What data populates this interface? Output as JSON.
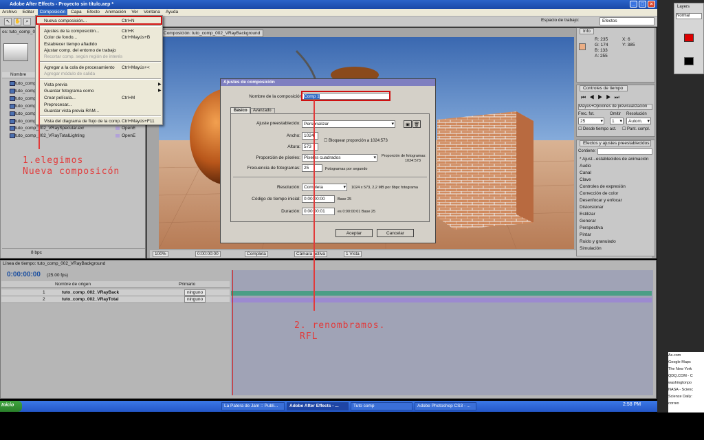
{
  "app": {
    "title": "Adobe After Effects - Proyecto sin título.aep *",
    "menu": [
      "Archivo",
      "Editar",
      "Composición",
      "Capa",
      "Efecto",
      "Animación",
      "Ver",
      "Ventana",
      "Ayuda"
    ],
    "workspace_label": "Espacio de trabajo:",
    "workspace_value": "Efectos"
  },
  "composition_menu": {
    "items": [
      {
        "label": "Nueva composición...",
        "shortcut": "Ctrl+N"
      },
      {
        "label": "Ajustes de la composición...",
        "shortcut": "Ctrl+K"
      },
      {
        "label": "Color de fondo...",
        "shortcut": "Ctrl+Mayús+B"
      },
      {
        "label": "Establecer tiempo añadido",
        "shortcut": ""
      },
      {
        "label": "Ajustar comp. del entorno de trabajo",
        "shortcut": ""
      },
      {
        "label": "Recortar comp. según región de interés",
        "shortcut": ""
      },
      {
        "label": "Agregar a la cola de procesamiento",
        "shortcut": "Ctrl+Mayús+<"
      },
      {
        "label": "Agregar módulo de salida",
        "shortcut": ""
      },
      {
        "label": "Vista previa",
        "shortcut": ""
      },
      {
        "label": "Guardar fotograma como",
        "shortcut": ""
      },
      {
        "label": "Crear película...",
        "shortcut": "Ctrl+M"
      },
      {
        "label": "Preprocesar...",
        "shortcut": ""
      },
      {
        "label": "Guardar vista previa RAM...",
        "shortcut": ""
      },
      {
        "label": "Vista del diagrama de flujo de la comp.",
        "shortcut": "Ctrl+Mayús+F11"
      }
    ]
  },
  "project": {
    "tab": "os: tuto_comp_00",
    "column_name": "Nombre",
    "items": [
      {
        "name": "tuto_comp_",
        "type": ""
      },
      {
        "name": "tuto_comp_",
        "type": ""
      },
      {
        "name": "tuto_comp_",
        "type": ""
      },
      {
        "name": "tuto_comp_",
        "type": ""
      },
      {
        "name": "tuto_comp_",
        "type": ""
      },
      {
        "name": "tuto_comp_",
        "type": ""
      },
      {
        "name": "tuto_comp_002_VRaySpecular.exr",
        "type": "OpenE"
      },
      {
        "name": "tuto_comp_002_VRayTotalLighting",
        "type": "OpenE"
      }
    ],
    "bpc": "8 bpc"
  },
  "viewer": {
    "tab": "Composición: tuto_comp_002_VRayBackground",
    "zoom": "100%",
    "time": "0:00:00:00",
    "quality": "Completa",
    "camera": "Cámara activa",
    "views": "1 Vista"
  },
  "info_panel": {
    "tab": "Info",
    "r": "R: 235",
    "g": "G: 174",
    "b": "B: 133",
    "a": "A: 255",
    "x": "X: 6",
    "y": "Y: 385"
  },
  "time_controls": {
    "tab": "Controles de tiempo",
    "ram_preview": "Mayús+Opciones de previsualización",
    "frame_rate_label": "Frec. fot.",
    "frame_rate": "25",
    "skip_label": "Omitir",
    "skip": "1",
    "resolution_label": "Resolución",
    "resolution": "Autom.",
    "from_current": "Desde tiempo act.",
    "full_screen": "Pant. compl."
  },
  "effects_panel": {
    "tab": "Efectos y ajustes preestablecidos",
    "contains_label": "Contiene:",
    "items": [
      "* Ajust...establecidos de animación",
      "Audio",
      "Canal",
      "Clave",
      "Controles de expresión",
      "Corrección de color",
      "Desenfocar y enfocar",
      "Distorsionar",
      "Estilizar",
      "Generar",
      "Perspectiva",
      "Pintar",
      "Ruido y granulado",
      "Simulación"
    ]
  },
  "timeline": {
    "tab": "Línea de tiempo: tuto_comp_002_VRayBackground",
    "timecode": "0:00:00:00",
    "fps": "(25.00 fps)",
    "col_source": "Nombre de origen",
    "col_parent": "Primario",
    "layers": [
      {
        "num": "1",
        "name": "tuto_comp_002_VRayBack",
        "parent": "ninguno"
      },
      {
        "num": "2",
        "name": "tuto_comp_002_VRayTotal",
        "parent": "ninguno"
      }
    ]
  },
  "dialog": {
    "title": "Ajustes de composición",
    "name_label": "Nombre de la composición:",
    "name_value": "Comp 1",
    "tab_basic": "Básico",
    "tab_advanced": "Avanzado",
    "preset_label": "Ajuste preestablecido:",
    "preset_value": "Personalizar",
    "width_label": "Ancho:",
    "width": "1024",
    "height_label": "Altura:",
    "height": "573",
    "lock_ratio": "Bloquear proporción a 1024:573",
    "pixel_aspect_label": "Proporción de píxeles:",
    "pixel_aspect_value": "Píxeles cuadrados",
    "frame_aspect_label": "Proporción de fotogramas:",
    "frame_aspect_value": "1024:573",
    "frame_rate_label": "Frecuencia de fotogramas:",
    "frame_rate_value": "25",
    "frame_rate_unit": "Fotogramas por segundo",
    "resolution_label": "Resolución:",
    "resolution_value": "Completa",
    "resolution_note": "1024 x 573, 2,2 MB por 8bpc fotograma",
    "start_tc_label": "Código de tiempo inicial:",
    "start_tc_value": "0:00:00:00",
    "start_tc_note": "Base 25",
    "duration_label": "Duración:",
    "duration_value": "0:00:00:01",
    "duration_note": "es 0:00:00:01  Base 25",
    "ok": "Aceptar",
    "cancel": "Cancelar"
  },
  "annotations": {
    "step1_line1": "1.elegimos",
    "step1_line2": "Nueva composicón",
    "step2_line1": "2. renombramos.",
    "step2_line2": "RFL",
    "color": "#e23a3a"
  },
  "taskbar": {
    "start": "Inicio",
    "items": [
      "La Patera de Jam :: Publi...",
      "Adobe After Effects - ...",
      "Tuto comp",
      "Adobe Photoshop CS3 - ..."
    ],
    "clock": "2:58 PM"
  },
  "side": {
    "layers_tab": "Layers",
    "mode": "Normal",
    "bookmarks": [
      "As.com",
      "Google Maps",
      "The New York",
      "QDQ.COM - C",
      "washingtonpo",
      "NASA - Scienc",
      "Science Daily:",
      "correo"
    ]
  }
}
